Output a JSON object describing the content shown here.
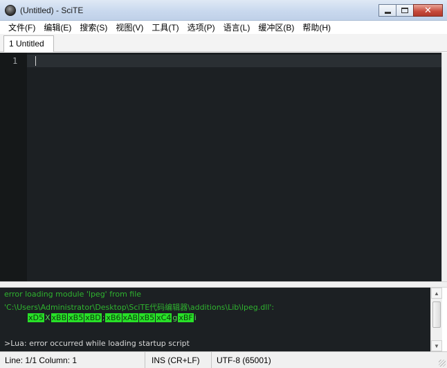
{
  "window": {
    "title": "(Untitled) - SciTE",
    "controls": {
      "minimize_icon": "minimize-icon",
      "maximize_icon": "maximize-icon",
      "close_glyph": "✕"
    }
  },
  "menu": {
    "items": [
      {
        "label": "文件(F)"
      },
      {
        "label": "编辑(E)"
      },
      {
        "label": "搜索(S)"
      },
      {
        "label": "视图(V)"
      },
      {
        "label": "工具(T)"
      },
      {
        "label": "选项(P)"
      },
      {
        "label": "语言(L)"
      },
      {
        "label": "缓冲区(B)"
      },
      {
        "label": "帮助(H)"
      }
    ]
  },
  "tabs": [
    {
      "label": "1 Untitled",
      "active": true
    }
  ],
  "editor": {
    "line_numbers": [
      "1"
    ],
    "background": "#1c2023"
  },
  "output": {
    "lines": [
      "error loading module 'lpeg' from file",
      "'C:\\Users\\Administrator\\Desktop\\SciTE代码编辑器\\additions\\Lib\\lpeg.dll':",
      ">Lua: error occurred while loading startup script"
    ],
    "garbled_tokens": [
      "xD5",
      "X",
      "xBB",
      "xB5",
      "xBD",
      ";",
      "xB6",
      "xAB",
      "xB5",
      "xC4",
      "g",
      "xBF",
      "i"
    ],
    "colors": {
      "error_text": "#2fb32f",
      "garbled_highlight": "#28e028",
      "lua_text": "#d8d8d8"
    }
  },
  "status": {
    "position": "Line: 1/1  Column: 1",
    "eol": "INS (CR+LF)",
    "encoding": "UTF-8 (65001)"
  }
}
